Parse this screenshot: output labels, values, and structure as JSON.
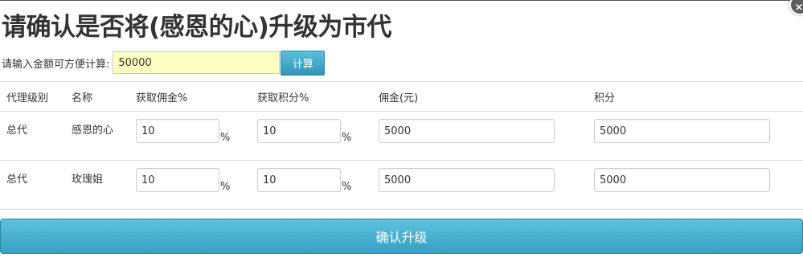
{
  "dialog": {
    "title": "请确认是否将(感恩的心)升级为市代",
    "close_glyph": "×"
  },
  "calculator": {
    "label": "请输入金额可方便计算:",
    "amount": "50000",
    "button_label": "计算"
  },
  "table": {
    "headers": [
      "代理级别",
      "名称",
      "获取佣金%",
      "获取积分%",
      "佣金(元)",
      "积分"
    ],
    "percent_sign": "%",
    "rows": [
      {
        "level": "总代",
        "name": "感恩的心",
        "commission_pct": "10",
        "points_pct": "10",
        "commission": "5000",
        "points": "5000"
      },
      {
        "level": "总代",
        "name": "玫瑰姐",
        "commission_pct": "10",
        "points_pct": "10",
        "commission": "5000",
        "points": "5000"
      }
    ]
  },
  "confirm_button_label": "确认升级"
}
